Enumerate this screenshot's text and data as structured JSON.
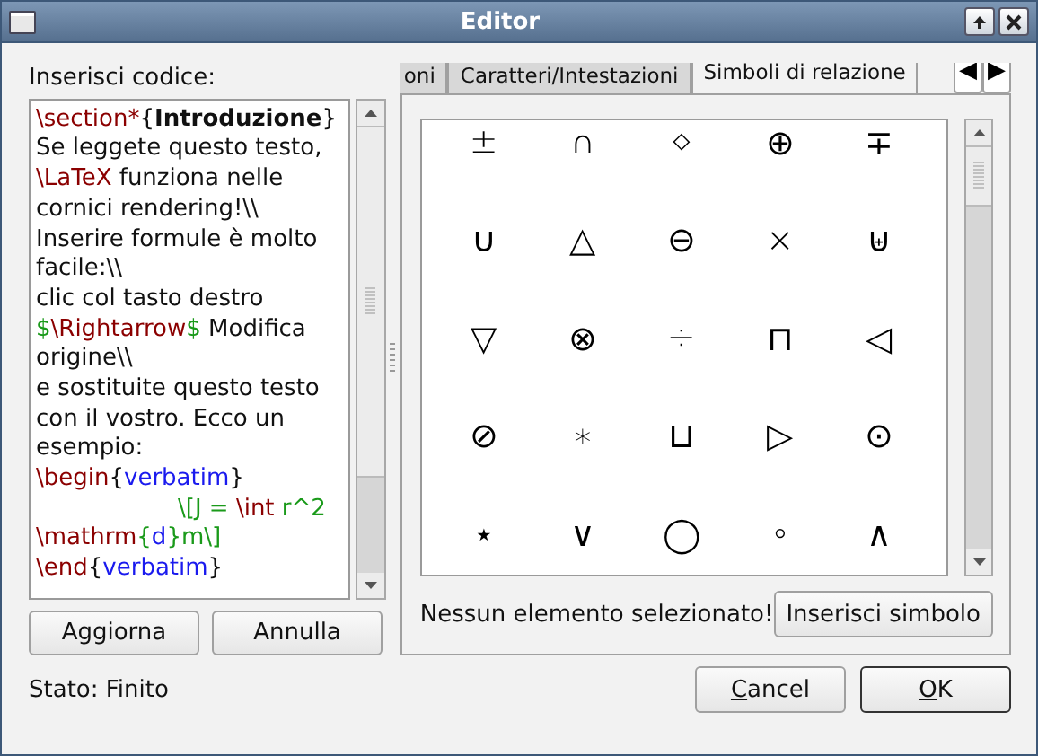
{
  "window": {
    "title": "Editor"
  },
  "code_label": "Inserisci codice:",
  "code_lines": [
    {
      "indent": false,
      "segments": [
        {
          "kind": "command",
          "text": "\\section*"
        },
        {
          "kind": "plain",
          "text": "{"
        },
        {
          "kind": "bold",
          "text": "Introduzione"
        },
        {
          "kind": "plain",
          "text": "}"
        }
      ]
    },
    {
      "indent": false,
      "segments": [
        {
          "kind": "plain",
          "text": "Se leggete questo testo,"
        }
      ]
    },
    {
      "indent": false,
      "segments": [
        {
          "kind": "command",
          "text": "\\LaTeX"
        },
        {
          "kind": "plain",
          "text": " funziona nelle"
        }
      ]
    },
    {
      "indent": false,
      "segments": [
        {
          "kind": "plain",
          "text": "cornici rendering!\\\\"
        }
      ]
    },
    {
      "indent": false,
      "segments": [
        {
          "kind": "plain",
          "text": "Inserire formule è molto"
        }
      ]
    },
    {
      "indent": false,
      "segments": [
        {
          "kind": "plain",
          "text": "facile:\\\\"
        }
      ]
    },
    {
      "indent": false,
      "segments": [
        {
          "kind": "plain",
          "text": "clic col tasto destro"
        }
      ]
    },
    {
      "indent": false,
      "segments": [
        {
          "kind": "math",
          "text": "$"
        },
        {
          "kind": "command",
          "text": "\\Rightarrow"
        },
        {
          "kind": "math",
          "text": "$"
        },
        {
          "kind": "plain",
          "text": " Modifica"
        }
      ]
    },
    {
      "indent": false,
      "segments": [
        {
          "kind": "plain",
          "text": "origine\\\\"
        }
      ]
    },
    {
      "indent": false,
      "segments": [
        {
          "kind": "plain",
          "text": "e sostituite questo testo"
        }
      ]
    },
    {
      "indent": false,
      "segments": [
        {
          "kind": "plain",
          "text": "con il vostro. Ecco un"
        }
      ]
    },
    {
      "indent": false,
      "segments": [
        {
          "kind": "plain",
          "text": "esempio:"
        }
      ]
    },
    {
      "indent": false,
      "segments": [
        {
          "kind": "command",
          "text": "\\begin"
        },
        {
          "kind": "plain",
          "text": "{"
        },
        {
          "kind": "argument",
          "text": "verbatim"
        },
        {
          "kind": "plain",
          "text": "}"
        }
      ]
    },
    {
      "indent": true,
      "segments": [
        {
          "kind": "math",
          "text": "\\[J = "
        },
        {
          "kind": "command",
          "text": "\\int"
        },
        {
          "kind": "math",
          "text": " r^2"
        }
      ]
    },
    {
      "indent": false,
      "segments": [
        {
          "kind": "command",
          "text": "\\mathrm"
        },
        {
          "kind": "math",
          "text": "{"
        },
        {
          "kind": "argument",
          "text": "d"
        },
        {
          "kind": "math",
          "text": "}m\\]"
        }
      ]
    },
    {
      "indent": false,
      "segments": [
        {
          "kind": "command",
          "text": "\\end"
        },
        {
          "kind": "plain",
          "text": "{"
        },
        {
          "kind": "argument",
          "text": "verbatim"
        },
        {
          "kind": "plain",
          "text": "}"
        }
      ]
    }
  ],
  "left_buttons": [
    "Aggiorna",
    "Annulla"
  ],
  "tabs": [
    {
      "label": "oni",
      "selected": false
    },
    {
      "label": "Caratteri/Intestazioni",
      "selected": false
    },
    {
      "label": "Simboli di relazione",
      "selected": true
    }
  ],
  "tab_scroll": [
    "◀",
    "▶"
  ],
  "symbols": [
    "±",
    "∩",
    "⋄",
    "⊕",
    "∓",
    "∪",
    "△",
    "⊖",
    "×",
    "⊎",
    "▽",
    "⊗",
    "÷",
    "⊓",
    "◁",
    "⊘",
    "∗",
    "⊔",
    "▷",
    "⊙",
    "⋆",
    "∨",
    "◯",
    "∘",
    "∧"
  ],
  "selection_message": "Nessun elemento selezionato!",
  "insert_button": "Inserisci simbolo",
  "status": "Stato: Finito",
  "dialog_buttons": [
    {
      "label": "Cancel",
      "default": false
    },
    {
      "label": "OK",
      "default": true
    }
  ]
}
